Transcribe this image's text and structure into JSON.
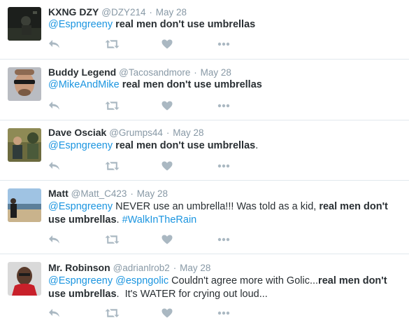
{
  "icons": {
    "reply": "reply-icon",
    "retweet": "retweet-icon",
    "like": "heart-icon",
    "more": "more-icon"
  },
  "colors": {
    "link": "#1b95e0",
    "muted": "#8899a6",
    "icon": "#aab8c2",
    "divider": "#e1e8ed"
  },
  "tweets": [
    {
      "name": "KXNG DZY",
      "handle": "@DZY214",
      "separator": "·",
      "time": "May 28",
      "segments": [
        {
          "text": "@Espngreeny",
          "style": "mention"
        },
        {
          "text": " ",
          "style": "plain"
        },
        {
          "text": "real men don't use umbrellas",
          "style": "strong"
        }
      ]
    },
    {
      "name": "Buddy Legend",
      "handle": "@Tacosandmore",
      "separator": "·",
      "time": "May 28",
      "segments": [
        {
          "text": "@MikeAndMike",
          "style": "mention"
        },
        {
          "text": " ",
          "style": "plain"
        },
        {
          "text": "real men don't use umbrellas",
          "style": "strong"
        }
      ]
    },
    {
      "name": "Dave Osciak",
      "handle": "@Grumps44",
      "separator": "·",
      "time": "May 28",
      "segments": [
        {
          "text": "@Espngreeny",
          "style": "mention"
        },
        {
          "text": " ",
          "style": "plain"
        },
        {
          "text": "real men don't use umbrellas",
          "style": "strong"
        },
        {
          "text": ".",
          "style": "plain"
        }
      ]
    },
    {
      "name": "Matt",
      "handle": "@Matt_C423",
      "separator": "·",
      "time": "May 28",
      "segments": [
        {
          "text": "@Espngreeny",
          "style": "mention"
        },
        {
          "text": " NEVER use an umbrella!!! Was told as a kid, ",
          "style": "plain"
        },
        {
          "text": "real men don't use umbrellas",
          "style": "strong"
        },
        {
          "text": ". ",
          "style": "plain"
        },
        {
          "text": "#WalkInTheRain",
          "style": "hashtag"
        }
      ]
    },
    {
      "name": "Mr. Robinson",
      "handle": "@adrianlrob2",
      "separator": "·",
      "time": "May 28",
      "segments": [
        {
          "text": "@Espngreeny",
          "style": "mention"
        },
        {
          "text": " ",
          "style": "plain"
        },
        {
          "text": "@espngolic",
          "style": "mention"
        },
        {
          "text": " Couldn't agree more with Golic...",
          "style": "plain"
        },
        {
          "text": "real men don't use umbrellas",
          "style": "strong"
        },
        {
          "text": ".  It's WATER for crying out loud...",
          "style": "plain"
        }
      ]
    }
  ]
}
